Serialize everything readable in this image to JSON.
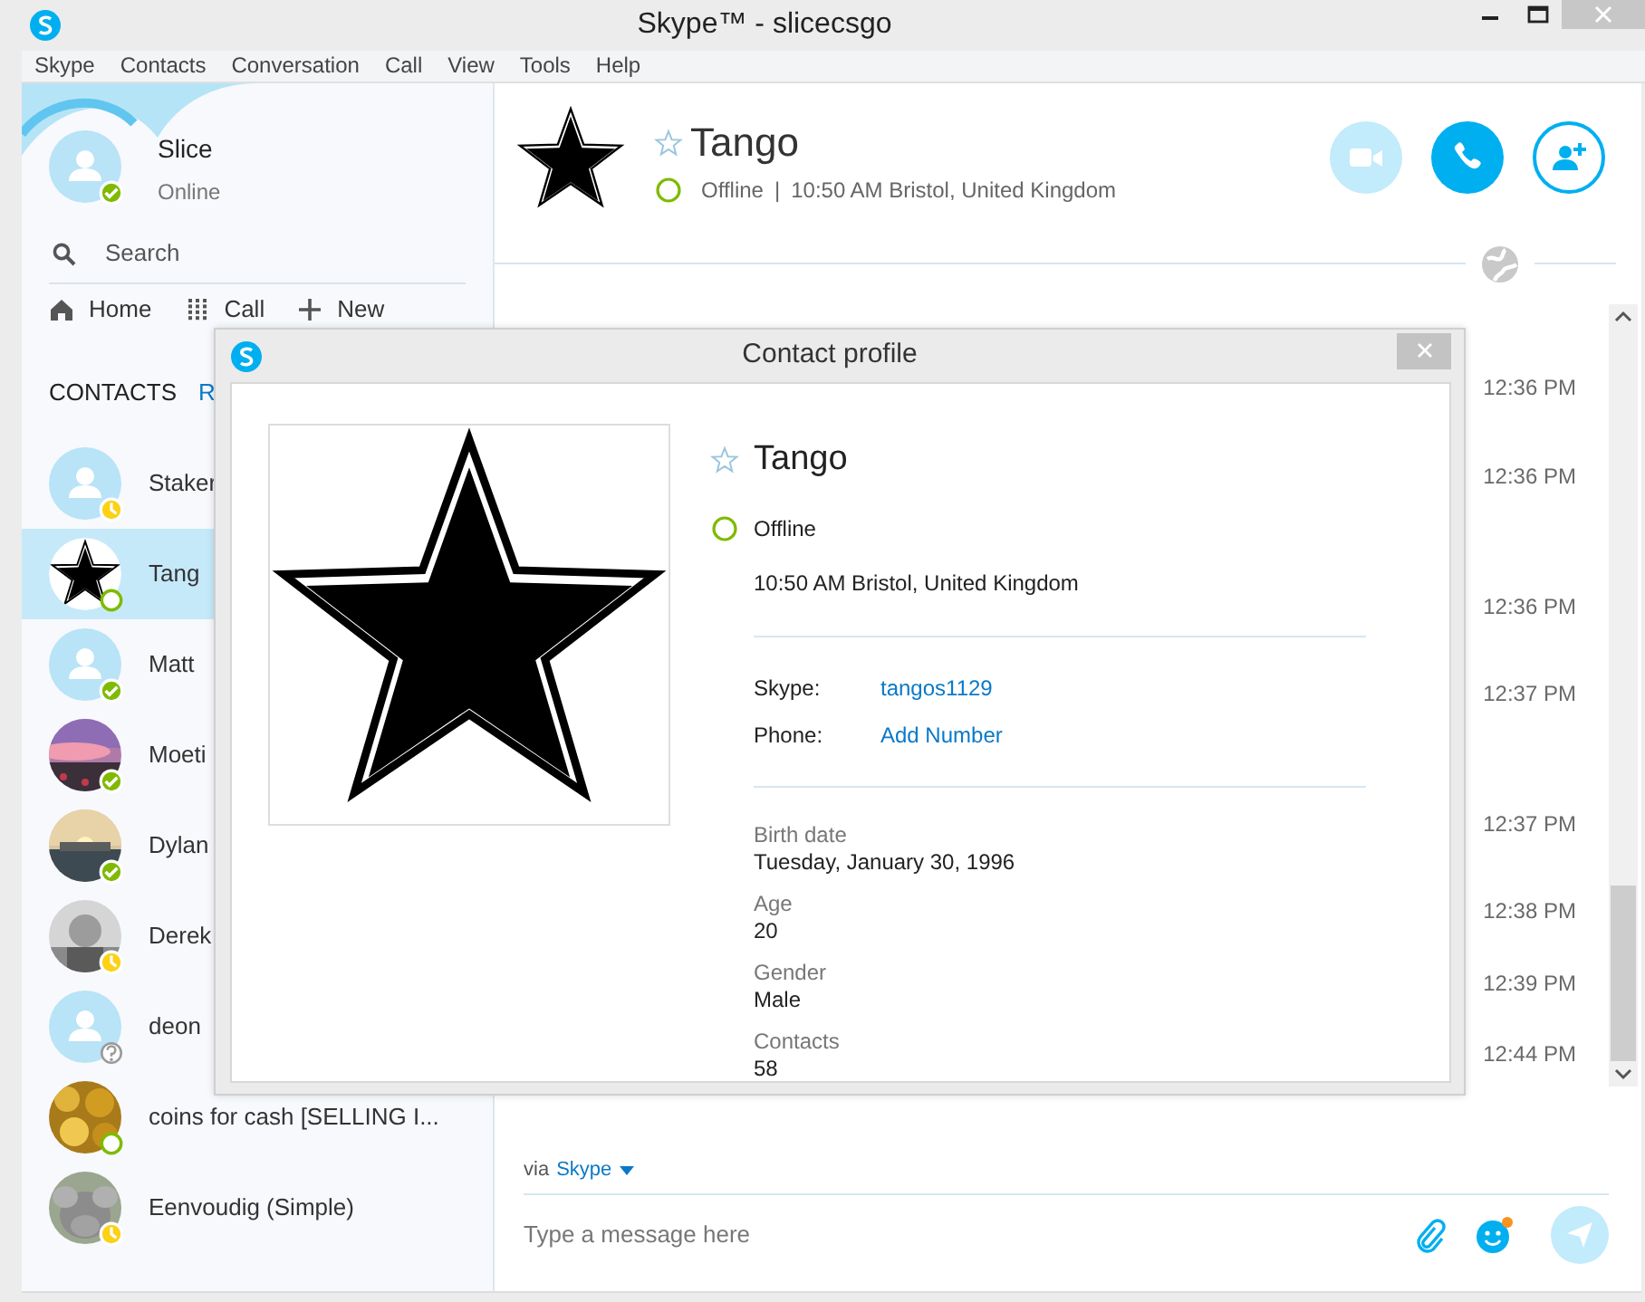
{
  "window": {
    "title": "Skype™ - slicecsgo"
  },
  "menu": [
    "Skype",
    "Contacts",
    "Conversation",
    "Call",
    "View",
    "Tools",
    "Help"
  ],
  "profile": {
    "name": "Slice",
    "status_text": "Online",
    "status": {
      "kind": "online"
    }
  },
  "search": {
    "placeholder": "Search"
  },
  "nav": [
    {
      "kind": "home",
      "label": "Home"
    },
    {
      "kind": "dialpad",
      "label": "Call"
    },
    {
      "kind": "plus",
      "label": "New"
    }
  ],
  "list_tabs": [
    {
      "label": "CONTACTS",
      "selected": true
    },
    {
      "label": "R",
      "selected": false
    }
  ],
  "contacts": [
    {
      "name": "Staker",
      "avatar": {
        "kind": "default"
      },
      "status": {
        "kind": "away"
      },
      "selected": false
    },
    {
      "name": "Tang",
      "avatar": {
        "kind": "star"
      },
      "status": {
        "kind": "offline"
      },
      "selected": true
    },
    {
      "name": "Matt",
      "avatar": {
        "kind": "default"
      },
      "status": {
        "kind": "online"
      },
      "selected": false
    },
    {
      "name": "Moeti",
      "status": {
        "kind": "online"
      },
      "selected": false
    },
    {
      "name": "Dylan",
      "status": {
        "kind": "online"
      },
      "selected": false
    },
    {
      "name": "Derek",
      "status": {
        "kind": "away"
      },
      "selected": false
    },
    {
      "name": "deon",
      "avatar": {
        "kind": "default"
      },
      "status": {
        "kind": "unknown"
      },
      "selected": false
    },
    {
      "name": "coins for cash [SELLING I...",
      "status": {
        "kind": "offline"
      },
      "selected": false
    },
    {
      "name": "Eenvoudig (Simple)",
      "status": {
        "kind": "away"
      },
      "selected": false
    }
  ],
  "conversation": {
    "name": "Tango",
    "favorite": false,
    "status": {
      "kind": "offline"
    },
    "status_text": "Offline",
    "separator": "|",
    "location": "10:50 AM Bristol, United Kingdom"
  },
  "call_buttons": [
    {
      "kind": "video",
      "disabled": true
    },
    {
      "kind": "call",
      "disabled": false
    },
    {
      "kind": "add-contact",
      "disabled": false
    }
  ],
  "timestamps": [
    "12:36 PM",
    "12:36 PM",
    "12:36 PM",
    "12:37 PM",
    "12:37 PM",
    "12:38 PM",
    "12:39 PM",
    "12:44 PM"
  ],
  "composer": {
    "via_label": "via",
    "via_service": "Skype",
    "placeholder": "Type a message here"
  },
  "dialog": {
    "title": "Contact profile",
    "name": "Tango",
    "favorite": false,
    "status": {
      "kind": "offline"
    },
    "status_text": "Offline",
    "local_time": "10:50 AM Bristol, United Kingdom",
    "fields": [
      {
        "label": "Skype:",
        "value": "tangos1129"
      },
      {
        "label": "Phone:",
        "value": "Add Number"
      }
    ],
    "details": [
      {
        "label": "Birth date",
        "value": "Tuesday, January 30, 1996"
      },
      {
        "label": "Age",
        "value": "20"
      },
      {
        "label": "Gender",
        "value": "Male"
      },
      {
        "label": "Contacts",
        "value": "58"
      }
    ]
  }
}
